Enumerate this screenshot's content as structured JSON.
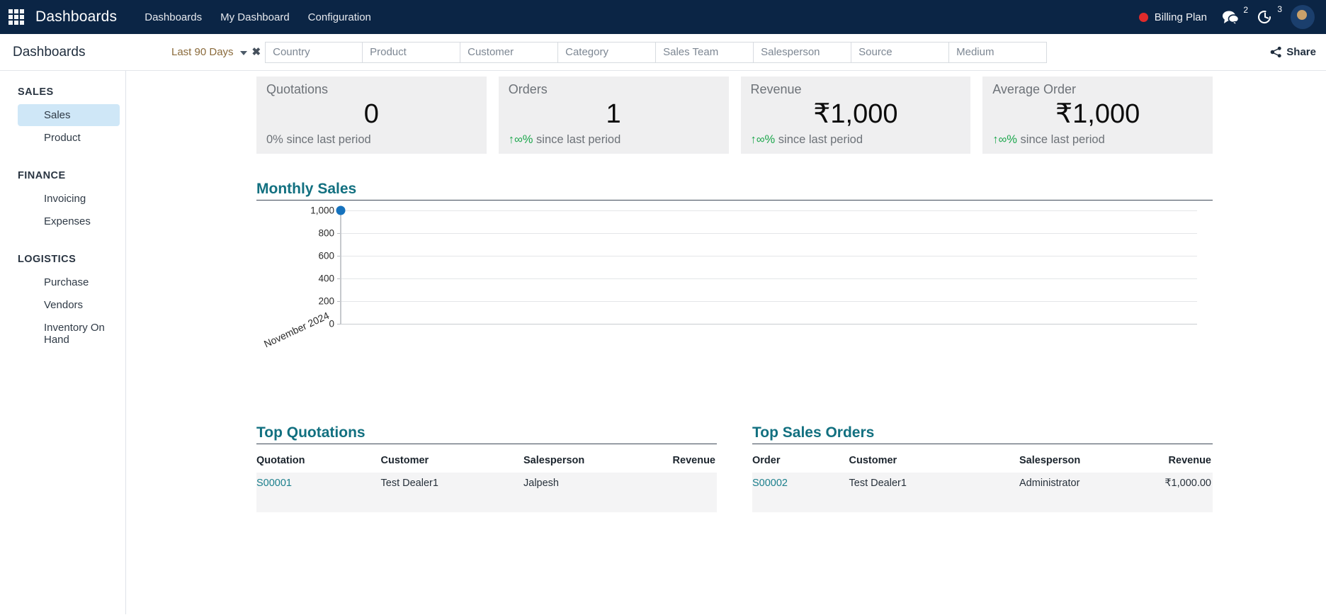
{
  "navbar": {
    "apps_icon": "apps-grid-icon",
    "brand": "Dashboards",
    "menu": [
      {
        "label": "Dashboards"
      },
      {
        "label": "My Dashboard"
      },
      {
        "label": "Configuration"
      }
    ],
    "billing_label": "Billing Plan",
    "billing_dot_color": "#e02b2b",
    "messages_icon": "messages-icon",
    "messages_count": "2",
    "activities_icon": "activity-clock-icon",
    "activities_count": "3",
    "background": "#0b2545"
  },
  "controlbar": {
    "title": "Dashboards",
    "period": {
      "value": "Last 90 Days",
      "value_color": "#8a6a3b",
      "dropdown_icon": "chevron-down-icon",
      "clear_icon": "close-x-icon"
    },
    "filters": [
      {
        "placeholder": "Country"
      },
      {
        "placeholder": "Product"
      },
      {
        "placeholder": "Customer"
      },
      {
        "placeholder": "Category"
      },
      {
        "placeholder": "Sales Team"
      },
      {
        "placeholder": "Salesperson"
      },
      {
        "placeholder": "Source"
      },
      {
        "placeholder": "Medium"
      }
    ],
    "share_label": "Share",
    "share_icon": "share-nodes-icon"
  },
  "sidebar": {
    "groups": [
      {
        "label": "SALES",
        "items": [
          {
            "label": "Sales",
            "active": true
          },
          {
            "label": "Product",
            "active": false
          }
        ]
      },
      {
        "label": "FINANCE",
        "items": [
          {
            "label": "Invoicing",
            "active": false
          },
          {
            "label": "Expenses",
            "active": false
          }
        ]
      },
      {
        "label": "LOGISTICS",
        "items": [
          {
            "label": "Purchase",
            "active": false
          },
          {
            "label": "Vendors",
            "active": false
          },
          {
            "label": "Inventory On Hand",
            "active": false
          }
        ]
      }
    ],
    "active_color": "#cfe7f7"
  },
  "kpis": [
    {
      "title": "Quotations",
      "value": "0",
      "change_arrow": "",
      "change_value": "0%",
      "change_suffix": " since last period",
      "change_color": "#6d7278"
    },
    {
      "title": "Orders",
      "value": "1",
      "change_arrow": "↑",
      "change_value": "∞%",
      "change_suffix": " since last period",
      "change_color": "#1aa64b"
    },
    {
      "title": "Revenue",
      "value": "₹1,000",
      "change_arrow": "↑",
      "change_value": "∞%",
      "change_suffix": " since last period",
      "change_color": "#1aa64b"
    },
    {
      "title": "Average Order",
      "value": "₹1,000",
      "change_arrow": "↑",
      "change_value": "∞%",
      "change_suffix": " since last period",
      "change_color": "#1aa64b"
    }
  ],
  "chart_section": {
    "title": "Monthly Sales"
  },
  "chart_data": {
    "type": "line",
    "title": "Monthly Sales",
    "xlabel": "",
    "ylabel": "",
    "categories": [
      "November 2024"
    ],
    "x": [
      "November 2024"
    ],
    "series": [
      {
        "name": "Monthly Sales",
        "values": [
          1000
        ],
        "color": "#1572bd"
      }
    ],
    "values": [
      1000
    ],
    "ylim": [
      0,
      1000
    ],
    "yticks": [
      0,
      200,
      400,
      600,
      800,
      1000
    ],
    "ytick_labels": [
      "0",
      "200",
      "400",
      "600",
      "800",
      "1,000"
    ],
    "grid": true,
    "legend": false,
    "marker": "circle",
    "xtick_rotation": -25
  },
  "tables": [
    {
      "title": "Top Quotations",
      "name": "top-quotations",
      "columns": [
        "Quotation",
        "Customer",
        "Salesperson",
        "Revenue"
      ],
      "rows": [
        {
          "quotation": "S00001",
          "customer": "Test Dealer1",
          "salesperson": "Jalpesh",
          "revenue": ""
        }
      ]
    },
    {
      "title": "Top Sales Orders",
      "name": "top-sales-orders",
      "columns": [
        "Order",
        "Customer",
        "Salesperson",
        "Revenue"
      ],
      "rows": [
        {
          "quotation": "S00002",
          "customer": "Test Dealer1",
          "salesperson": "Administrator",
          "revenue": "₹1,000.00"
        }
      ]
    }
  ]
}
